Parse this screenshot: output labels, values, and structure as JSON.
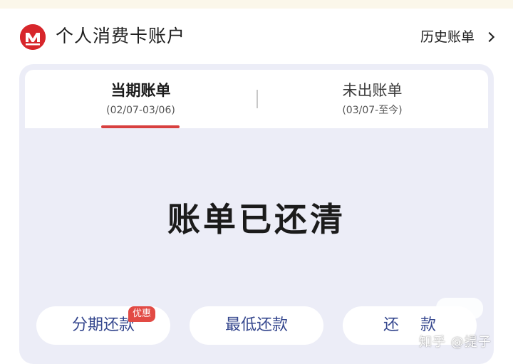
{
  "header": {
    "title": "个人消费卡账户",
    "history_link": "历史账单",
    "logo_icon": "bank-logo-icon",
    "arrow_icon": "chevron-right-icon"
  },
  "tabs": [
    {
      "label": "当期账单",
      "range": "(02/07-03/06)",
      "selected": true
    },
    {
      "label": "未出账单",
      "range": "(03/07-至今)",
      "selected": false
    }
  ],
  "status": {
    "text": "账单已还清"
  },
  "actions": {
    "installment": "分期还款",
    "installment_badge": "优惠",
    "minimum": "最低还款",
    "repay": "还款"
  },
  "watermark": "知乎 @提子",
  "colors": {
    "brand_red": "#d7262b",
    "button_text": "#35478e",
    "badge_red": "#e24a44",
    "card_background": "#ecedf7"
  }
}
